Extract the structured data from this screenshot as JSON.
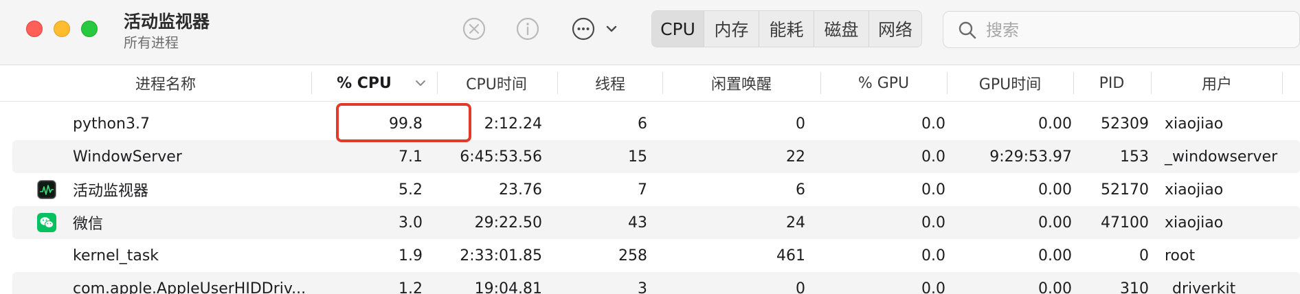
{
  "window": {
    "title": "活动监视器",
    "subtitle": "所有进程"
  },
  "toolbar": {
    "icons": [
      "stop-process-icon",
      "info-icon",
      "more-icon",
      "chevron-down-icon"
    ],
    "tabs": [
      {
        "label": "CPU",
        "active": true
      },
      {
        "label": "内存",
        "active": false
      },
      {
        "label": "能耗",
        "active": false
      },
      {
        "label": "磁盘",
        "active": false
      },
      {
        "label": "网络",
        "active": false
      }
    ],
    "search": {
      "placeholder": "搜索",
      "value": ""
    }
  },
  "table": {
    "columns": [
      "进程名称",
      "% CPU",
      "CPU时间",
      "线程",
      "闲置唤醒",
      "% GPU",
      "GPU时间",
      "PID",
      "用户"
    ],
    "sorted_column": "% CPU",
    "rows": [
      {
        "icon": "",
        "name": "python3.7",
        "cpu": "99.8",
        "cpu_time": "2:12.24",
        "threads": "6",
        "idle_wakeups": "0",
        "gpu": "0.0",
        "gpu_time": "0.00",
        "pid": "52309",
        "user": "xiaojiao"
      },
      {
        "icon": "",
        "name": "WindowServer",
        "cpu": "7.1",
        "cpu_time": "6:45:53.56",
        "threads": "15",
        "idle_wakeups": "22",
        "gpu": "0.0",
        "gpu_time": "9:29:53.97",
        "pid": "153",
        "user": "_windowserver"
      },
      {
        "icon": "activity-monitor-icon",
        "name": "活动监视器",
        "cpu": "5.2",
        "cpu_time": "23.76",
        "threads": "7",
        "idle_wakeups": "6",
        "gpu": "0.0",
        "gpu_time": "0.00",
        "pid": "52170",
        "user": "xiaojiao"
      },
      {
        "icon": "wechat-icon",
        "name": "微信",
        "cpu": "3.0",
        "cpu_time": "29:22.50",
        "threads": "43",
        "idle_wakeups": "24",
        "gpu": "0.0",
        "gpu_time": "0.00",
        "pid": "47100",
        "user": "xiaojiao"
      },
      {
        "icon": "",
        "name": "kernel_task",
        "cpu": "1.9",
        "cpu_time": "2:33:01.85",
        "threads": "258",
        "idle_wakeups": "461",
        "gpu": "0.0",
        "gpu_time": "0.00",
        "pid": "0",
        "user": "root"
      },
      {
        "icon": "",
        "name": "com.apple.AppleUserHIDDriv...",
        "cpu": "1.2",
        "cpu_time": "19:04.81",
        "threads": "3",
        "idle_wakeups": "0",
        "gpu": "0.0",
        "gpu_time": "0.00",
        "pid": "310",
        "user": "_driverkit"
      }
    ]
  },
  "annotation": {
    "highlighted_cell": "python3.7 % CPU",
    "color": "#e23a2a"
  },
  "colors": {
    "close": "#fe5f57",
    "minimize": "#febc2e",
    "zoom": "#28c840",
    "wechat": "#07c160"
  }
}
